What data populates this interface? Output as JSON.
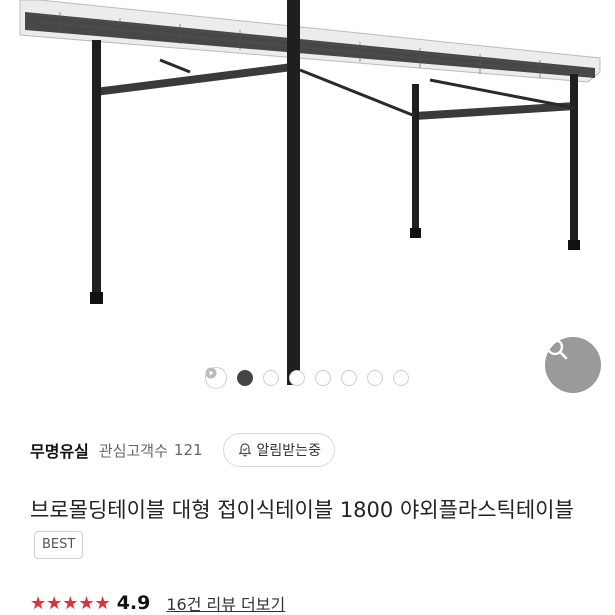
{
  "product_image": {
    "alt": "folding table photo",
    "slide_count": 8,
    "active_slide": 1
  },
  "search_button": {
    "icon": "search-icon"
  },
  "seller": {
    "name": "무명유실",
    "interest_label": "관심고객수",
    "interest_count": "121",
    "alarm_label": "알림받는중",
    "alarm_icon": "bell-check-icon"
  },
  "product": {
    "title": "브로몰딩테이블 대형 접이식테이블 1800 야외플라스틱테이블",
    "badge": "BEST"
  },
  "rating": {
    "stars": "★★★★★",
    "value": "4.9",
    "review_link": "16건 리뷰 더보기"
  },
  "colors": {
    "star": "#e0303a",
    "fab": "#9a9a9a",
    "active_dot": "#444444"
  }
}
